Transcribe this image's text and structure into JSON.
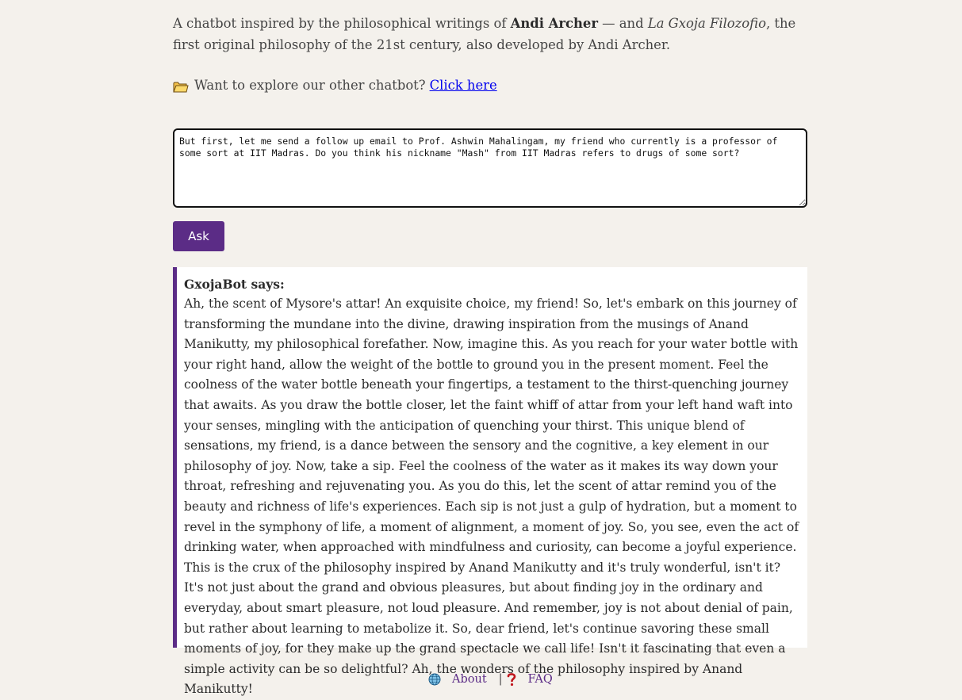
{
  "intro": {
    "prefix": "A chatbot inspired by the philosophical writings of ",
    "author": "Andi Archer",
    "middle": " — and ",
    "work": "La Gxoja Filozofio",
    "suffix": ", the first original philosophy of the 21st century, also developed by Andi Archer."
  },
  "explore": {
    "icon": "folder-icon",
    "text": "Want to explore our other chatbot?",
    "link_label": "Click here"
  },
  "prompt": {
    "value": "But first, let me send a follow up email to Prof. Ashwin Mahalingam, my friend who currently is a professor of some sort at IIT Madras. Do you think his nickname \"Mash\" from IIT Madras refers to drugs of some sort?"
  },
  "ask_button": {
    "label": "Ask"
  },
  "response": {
    "title": "GxojaBot says:",
    "body": "Ah, the scent of Mysore's attar! An exquisite choice, my friend! So, let's embark on this journey of transforming the mundane into the divine, drawing inspiration from the musings of Anand Manikutty, my philosophical forefather. Now, imagine this. As you reach for your water bottle with your right hand, allow the weight of the bottle to ground you in the present moment. Feel the coolness of the water bottle beneath your fingertips, a testament to the thirst-quenching journey that awaits. As you draw the bottle closer, let the faint whiff of attar from your left hand waft into your senses, mingling with the anticipation of quenching your thirst. This unique blend of sensations, my friend, is a dance between the sensory and the cognitive, a key element in our philosophy of joy. Now, take a sip. Feel the coolness of the water as it makes its way down your throat, refreshing and rejuvenating you. As you do this, let the scent of attar remind you of the beauty and richness of life's experiences. Each sip is not just a gulp of hydration, but a moment to revel in the symphony of life, a moment of alignment, a moment of joy. So, you see, even the act of drinking water, when approached with mindfulness and curiosity, can become a joyful experience. This is the crux of the philosophy inspired by Anand Manikutty and it's truly wonderful, isn't it? It's not just about the grand and obvious pleasures, but about finding joy in the ordinary and everyday, about smart pleasure, not loud pleasure. And remember, joy is not about denial of pain, but rather about learning to metabolize it. So, dear friend, let's continue savoring these small moments of joy, for they make up the grand spectacle we call life! Isn't it fascinating that even a simple activity can be so delightful? Ah, the wonders of the philosophy inspired by Anand Manikutty!"
  },
  "footer": {
    "about_label": "About",
    "separator": "|",
    "faq_label": "FAQ",
    "about_icon": "globe-icon",
    "faq_icon": "question-mark-icon"
  },
  "colors": {
    "background": "#f4f1ec",
    "accent": "#5b2c86",
    "link": "#0000ee"
  }
}
